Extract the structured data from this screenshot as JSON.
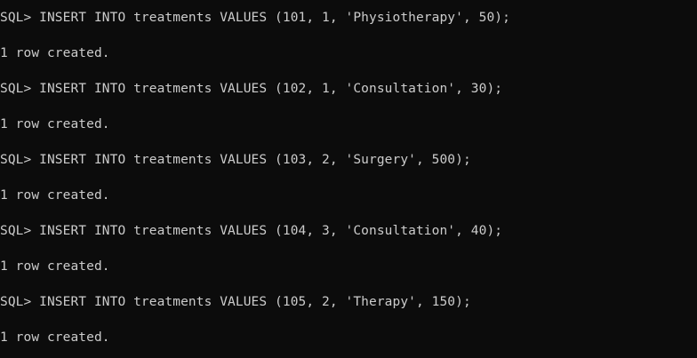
{
  "terminal": {
    "lines": [
      "SQL> INSERT INTO treatments VALUES (101, 1, 'Physiotherapy', 50);",
      "1 row created.",
      "SQL> INSERT INTO treatments VALUES (102, 1, 'Consultation', 30);",
      "1 row created.",
      "SQL> INSERT INTO treatments VALUES (103, 2, 'Surgery', 500);",
      "1 row created.",
      "SQL> INSERT INTO treatments VALUES (104, 3, 'Consultation', 40);",
      "1 row created.",
      "SQL> INSERT INTO treatments VALUES (105, 2, 'Therapy', 150);",
      "1 row created."
    ],
    "colors": {
      "background": "#0c0c0c",
      "text": "#cccccc"
    }
  }
}
